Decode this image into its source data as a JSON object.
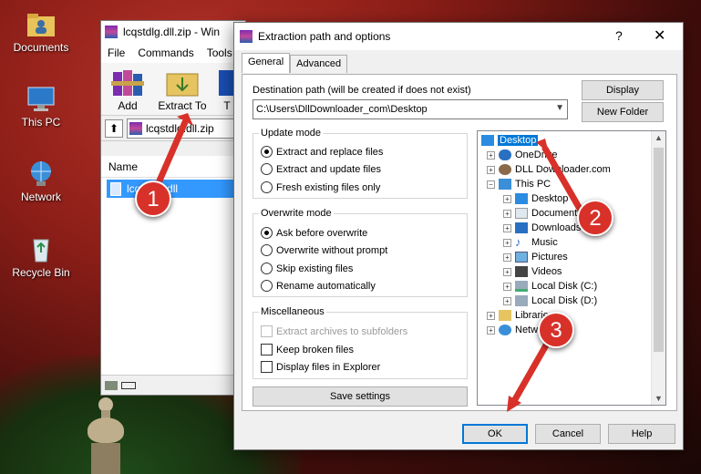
{
  "desktop": {
    "icons": [
      {
        "label": "Documents",
        "icon": "folder-user-icon"
      },
      {
        "label": "This PC",
        "icon": "computer-icon"
      },
      {
        "label": "Network",
        "icon": "network-icon"
      },
      {
        "label": "Recycle Bin",
        "icon": "recycle-bin-icon"
      }
    ]
  },
  "winrar": {
    "title": "lcqstdlg.dll.zip - Win",
    "menu": [
      "File",
      "Commands",
      "Tools"
    ],
    "toolbar": {
      "add": "Add",
      "extract": "Extract To",
      "partial": "T"
    },
    "address": "lcqstdlg.dll.zip",
    "column_name": "Name",
    "file": "lcqstdlg.dll"
  },
  "dialog": {
    "title": "Extraction path and options",
    "help": "?",
    "close": "✕",
    "tabs": [
      "General",
      "Advanced"
    ],
    "dest_label": "Destination path (will be created if does not exist)",
    "dest_value": "C:\\Users\\DllDownloader_com\\Desktop",
    "display_btn": "Display",
    "new_folder_btn": "New Folder",
    "update_mode": {
      "title": "Update mode",
      "options": [
        "Extract and replace files",
        "Extract and update files",
        "Fresh existing files only"
      ],
      "selected": 0
    },
    "overwrite_mode": {
      "title": "Overwrite mode",
      "options": [
        "Ask before overwrite",
        "Overwrite without prompt",
        "Skip existing files",
        "Rename automatically"
      ],
      "selected": 0
    },
    "misc": {
      "title": "Miscellaneous",
      "options": [
        "Extract archives to subfolders",
        "Keep broken files",
        "Display files in Explorer"
      ]
    },
    "save_settings": "Save settings",
    "tree": [
      "Desktop",
      "OneDrive",
      "DLL Downloader.com",
      "This PC",
      "Desktop",
      "Documents",
      "Downloads",
      "Music",
      "Pictures",
      "Videos",
      "Local Disk (C:)",
      "Local Disk (D:)",
      "Libraries",
      "Network"
    ],
    "ok": "OK",
    "cancel": "Cancel",
    "help_btn": "Help"
  },
  "steps": [
    "1",
    "2",
    "3"
  ],
  "colors": {
    "step": "#d8312a",
    "selection": "#0078d7"
  }
}
